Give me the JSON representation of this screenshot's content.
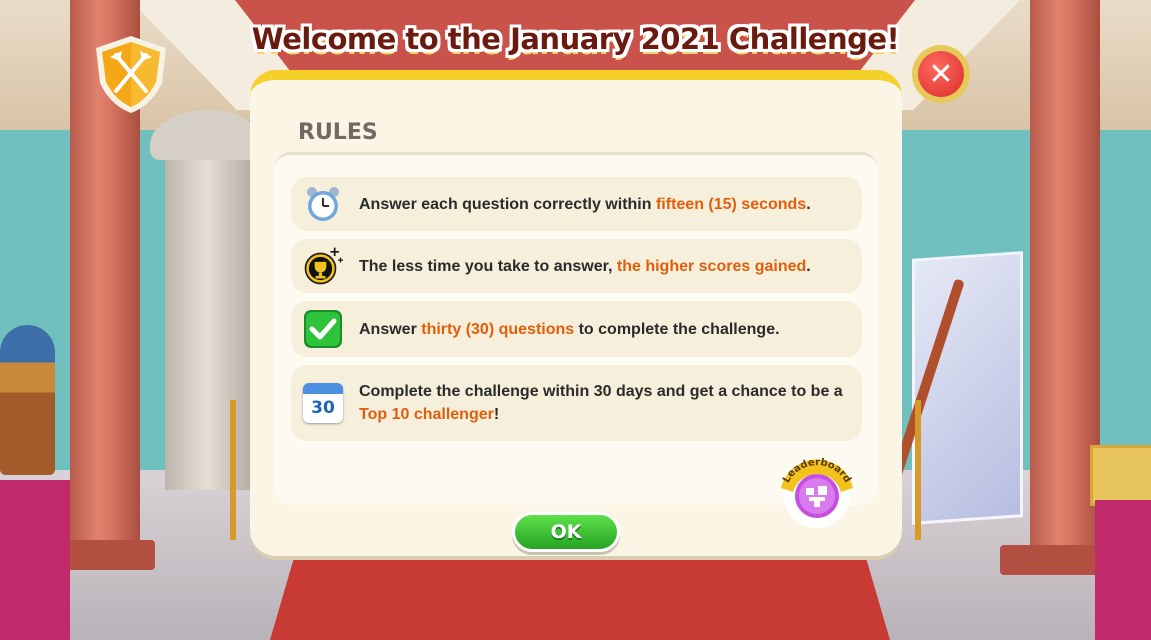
{
  "title": "Welcome to the January 2021 Challenge!",
  "rules_heading": "RULES",
  "rules": [
    {
      "icon": "alarm-clock-icon",
      "parts": [
        "Answer each question correctly within ",
        "fifteen (15) seconds",
        "."
      ]
    },
    {
      "icon": "trophy-icon",
      "parts": [
        "The less time you take to answer, ",
        "the higher scores gained",
        "."
      ]
    },
    {
      "icon": "checkmark-icon",
      "parts": [
        "Answer ",
        "thirty (30) questions",
        " to complete the challenge."
      ]
    },
    {
      "icon": "calendar-icon",
      "calendar_day": "30",
      "parts": [
        "Complete the challenge within 30 days and get a chance to be a ",
        "Top 10 challenger",
        "!"
      ]
    }
  ],
  "ok_label": "OK",
  "close_label": "✕",
  "leaderboard_label": "Leaderboard",
  "colors": {
    "highlight": "#e35e0b",
    "panel_top": "#f4d028",
    "ok_green": "#25a323",
    "close_red": "#d92b2b"
  }
}
